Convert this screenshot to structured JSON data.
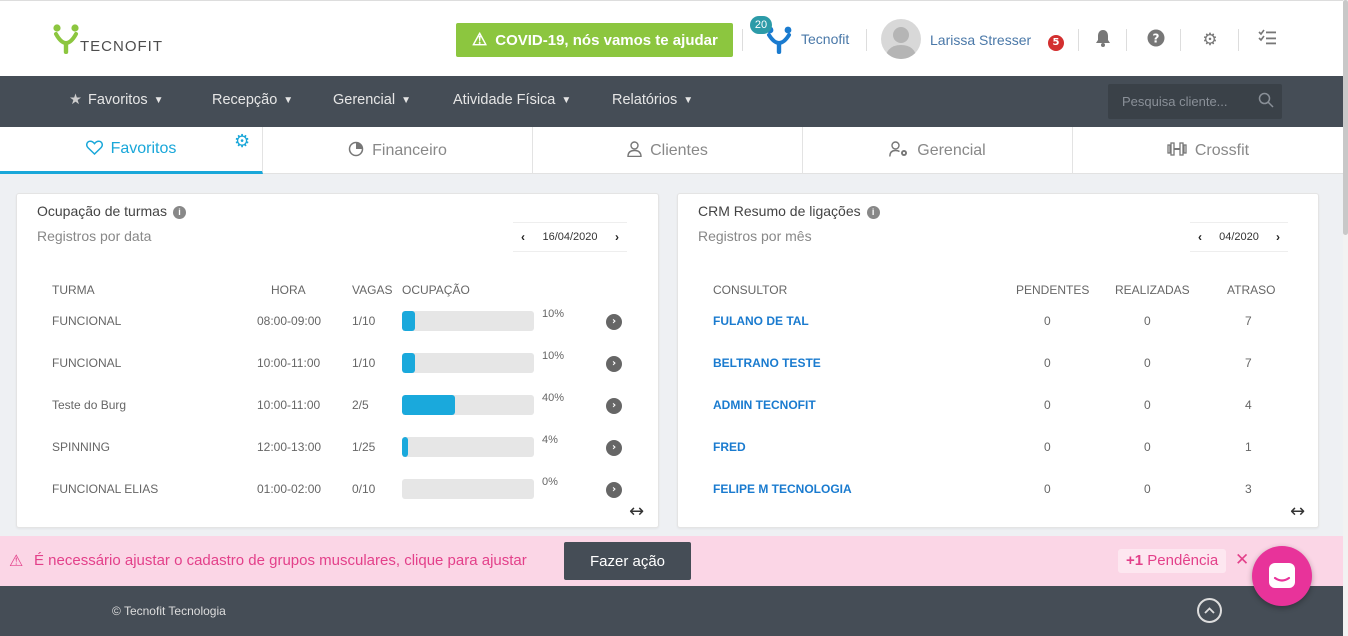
{
  "header": {
    "logo_text": "TECNOFIT",
    "covid_banner": "COVID-19, nós vamos te ajudar",
    "badge_count": "20",
    "company": "Tecnofit",
    "user_name": "Larissa Stresser",
    "notification_count": "5"
  },
  "nav": {
    "items": [
      {
        "label": "Favoritos"
      },
      {
        "label": "Recepção"
      },
      {
        "label": "Gerencial"
      },
      {
        "label": "Atividade Física"
      },
      {
        "label": "Relatórios"
      }
    ],
    "search_placeholder": "Pesquisa cliente..."
  },
  "tabs": [
    {
      "label": "Favoritos",
      "icon": "heart-icon"
    },
    {
      "label": "Financeiro",
      "icon": "pie-chart-icon"
    },
    {
      "label": "Clientes",
      "icon": "user-icon"
    },
    {
      "label": "Gerencial",
      "icon": "user-gear-icon"
    },
    {
      "label": "Crossfit",
      "icon": "dumbbell-icon"
    }
  ],
  "ocupacao": {
    "title": "Ocupação de turmas",
    "subtitle": "Registros por data",
    "date": "16/04/2020",
    "headers": [
      "TURMA",
      "HORA",
      "VAGAS",
      "OCUPAÇÃO"
    ],
    "rows": [
      {
        "turma": "FUNCIONAL",
        "hora": "08:00-09:00",
        "vagas": "1/10",
        "pct_label": "10%",
        "pct": 10
      },
      {
        "turma": "FUNCIONAL",
        "hora": "10:00-11:00",
        "vagas": "1/10",
        "pct_label": "10%",
        "pct": 10
      },
      {
        "turma": "Teste do Burg",
        "hora": "10:00-11:00",
        "vagas": "2/5",
        "pct_label": "40%",
        "pct": 40
      },
      {
        "turma": "SPINNING",
        "hora": "12:00-13:00",
        "vagas": "1/25",
        "pct_label": "4%",
        "pct": 4
      },
      {
        "turma": "FUNCIONAL ELIAS",
        "hora": "01:00-02:00",
        "vagas": "0/10",
        "pct_label": "0%",
        "pct": 0
      }
    ]
  },
  "crm": {
    "title": "CRM Resumo de ligações",
    "subtitle": "Registros por mês",
    "month": "04/2020",
    "headers": [
      "CONSULTOR",
      "PENDENTES",
      "REALIZADAS",
      "ATRASO"
    ],
    "rows": [
      {
        "consultor": "FULANO DE TAL",
        "pendentes": "0",
        "realizadas": "0",
        "atraso": "7"
      },
      {
        "consultor": "BELTRANO TESTE",
        "pendentes": "0",
        "realizadas": "0",
        "atraso": "7"
      },
      {
        "consultor": "ADMIN TECNOFIT",
        "pendentes": "0",
        "realizadas": "0",
        "atraso": "4"
      },
      {
        "consultor": "FRED",
        "pendentes": "0",
        "realizadas": "0",
        "atraso": "1"
      },
      {
        "consultor": "FELIPE M TECNOLOGIA",
        "pendentes": "0",
        "realizadas": "0",
        "atraso": "3"
      }
    ]
  },
  "alert": {
    "message": "É necessário ajustar o cadastro de grupos musculares, clique para ajustar",
    "action": "Fazer ação",
    "pending_count": "+1",
    "pending_label": "Pendência"
  },
  "footer": {
    "copyright": "© Tecnofit Tecnologia"
  },
  "colors": {
    "accent": "#1aa9dc",
    "covid": "#8cc63f",
    "nav_bg": "#454d56",
    "alert_bg": "#fbd6e6",
    "alert_text": "#e3408a",
    "link": "#1a7bcf"
  }
}
